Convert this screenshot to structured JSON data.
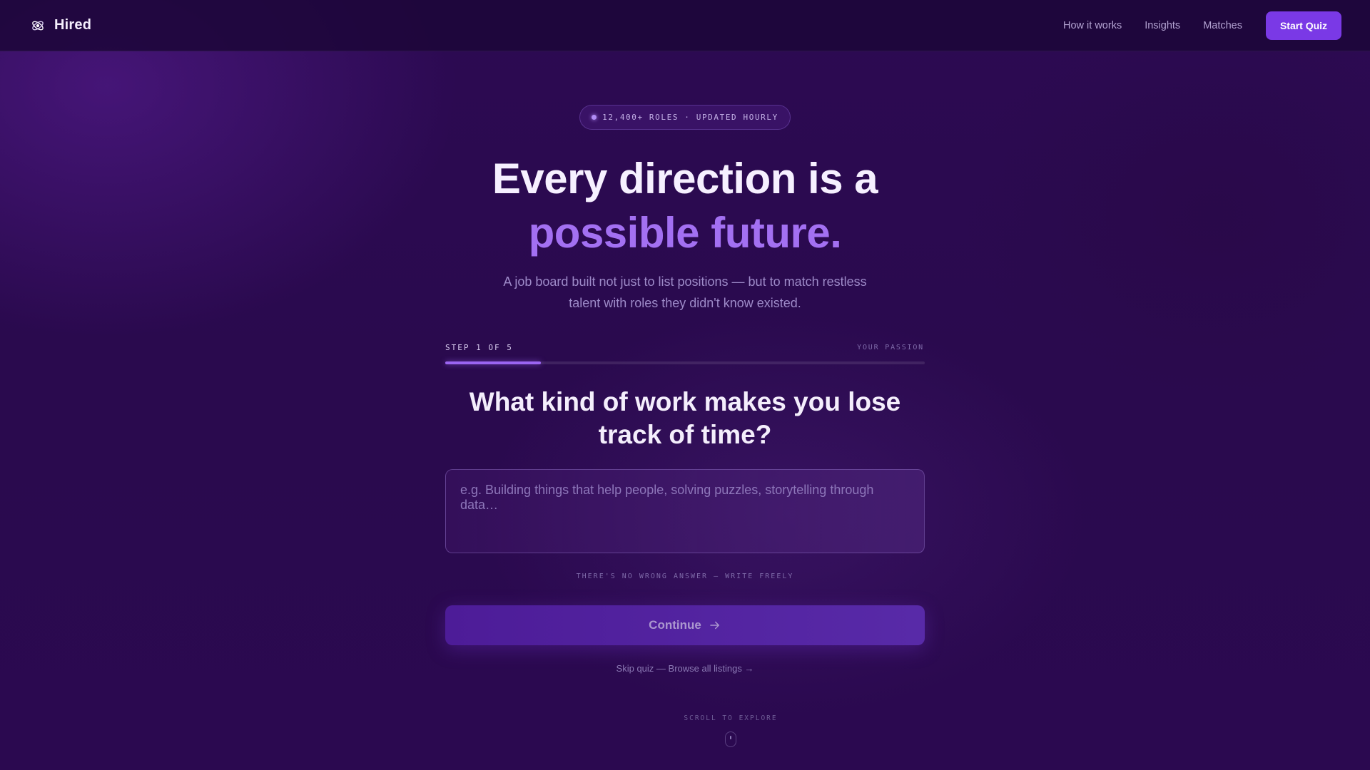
{
  "nav": {
    "brand": "Hired",
    "links": [
      "How it works",
      "Insights",
      "Matches"
    ],
    "cta": "Start Quiz"
  },
  "badge": {
    "text": "12,400+ ROLES · UPDATED HOURLY"
  },
  "hero": {
    "line1": "Every direction is a",
    "line2": "possible future.",
    "subtitle": "A job board built not just to list positions — but to match restless talent with roles they didn't know existed."
  },
  "quiz": {
    "step_label": "STEP 1 OF 5",
    "topic": "YOUR PASSION",
    "progress": 0.2,
    "question": "What kind of work makes you lose track of time?",
    "placeholder": "e.g. Building things that help people, solving puzzles, storytelling through data…",
    "value": "",
    "hint": "THERE'S NO WRONG ANSWER — WRITE FREELY",
    "continue_label": "Continue",
    "skip_link": "Skip quiz — Browse all listings →"
  },
  "footer": {
    "scroll_hint": "SCROLL TO EXPLORE"
  },
  "colors": {
    "accent": "#7a39e6",
    "highlight": "#a370f2",
    "background": "#2a0a4e"
  },
  "icons": {
    "brand": "orbit-icon",
    "continue": "arrow-right-icon",
    "scroll": "mouse-icon"
  }
}
